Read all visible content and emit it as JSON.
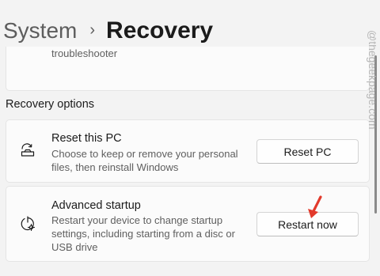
{
  "breadcrumb": {
    "parent": "System",
    "separator": "›",
    "current": "Recovery"
  },
  "partial_card": {
    "text": "troubleshooter"
  },
  "section": {
    "heading": "Recovery options"
  },
  "options": {
    "reset": {
      "icon": "reset-pc-icon",
      "title": "Reset this PC",
      "description": "Choose to keep or remove your personal files, then reinstall Windows",
      "button_label": "Reset PC"
    },
    "advanced": {
      "icon": "advanced-startup-icon",
      "title": "Advanced startup",
      "description": "Restart your device to change startup settings, including starting from a disc or USB drive",
      "button_label": "Restart now"
    }
  },
  "watermark": {
    "text": "@thegeekpage.com"
  },
  "colors": {
    "background": "#f3f3f3",
    "card": "#fbfbfb",
    "annotation_arrow": "#e23a2c"
  }
}
